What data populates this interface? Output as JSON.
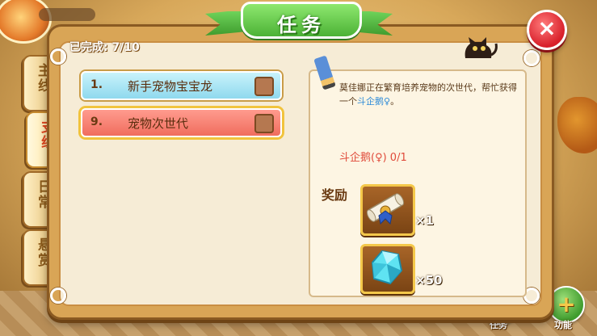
{
  "title": "任务",
  "close_label": "×",
  "tabs": [
    {
      "label": "主线",
      "active": false
    },
    {
      "label": "支线",
      "active": true
    },
    {
      "label": "日常",
      "active": false
    },
    {
      "label": "悬赏",
      "active": false
    }
  ],
  "progress": {
    "label": "已完成: 7/10"
  },
  "quests": [
    {
      "number": "1.",
      "name": "新手宠物宝宝龙",
      "selected": false
    },
    {
      "number": "9.",
      "name": "宠物次世代",
      "selected": true
    }
  ],
  "detail": {
    "description_prefix": "莫佳娜正在繁育培养宠物的次世代，帮忙获得一个",
    "description_link": "斗企鹅♀",
    "description_suffix": "。",
    "objective": "斗企鹅(♀) 0/1",
    "reward_heading": "奖励",
    "rewards": [
      {
        "icon": "scroll-icon",
        "count": "×1"
      },
      {
        "icon": "crystal-icon",
        "count": "×50"
      }
    ]
  },
  "hud": {
    "task_label": "任务",
    "function_label": "功能"
  },
  "colors": {
    "active_tab_text": "#e0461e",
    "link": "#2c8ad8",
    "objective": "#e04a3a"
  }
}
